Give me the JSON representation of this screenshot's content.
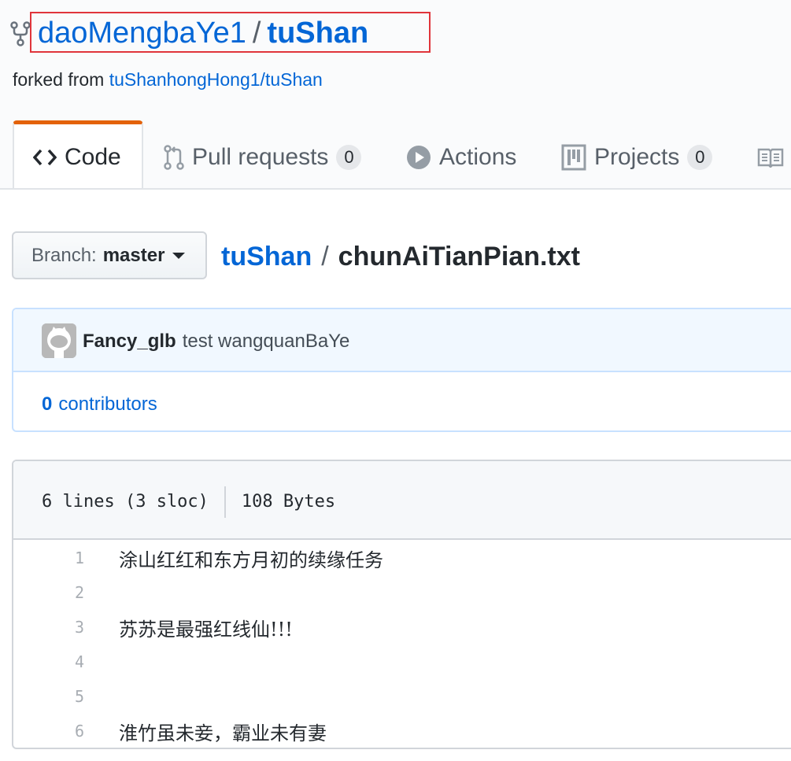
{
  "repo": {
    "owner": "daoMengbaYe1",
    "separator": "/",
    "name": "tuShan",
    "forked_prefix": "forked from",
    "forked_link": "tuShanhongHong1/tuShan"
  },
  "tabs": [
    {
      "label": "Code",
      "icon": "code-icon",
      "selected": true
    },
    {
      "label": "Pull requests",
      "icon": "pull-request-icon",
      "count": "0"
    },
    {
      "label": "Actions",
      "icon": "play-icon"
    },
    {
      "label": "Projects",
      "icon": "project-icon",
      "count": "0"
    },
    {
      "label": "",
      "icon": "book-icon"
    }
  ],
  "branch": {
    "label": "Branch:",
    "name": "master"
  },
  "breadcrumb": {
    "root": "tuShan",
    "separator": "/",
    "file": "chunAiTianPian.txt"
  },
  "commit": {
    "author": "Fancy_glb",
    "message": "test wangquanBaYe"
  },
  "contributors": {
    "count": "0",
    "label": "contributors"
  },
  "file": {
    "lines_info": "6 lines (3 sloc)",
    "size": "108 Bytes",
    "lines": [
      {
        "num": "1",
        "text": "涂山红红和东方月初的续缘任务"
      },
      {
        "num": "2",
        "text": ""
      },
      {
        "num": "3",
        "text": "苏苏是最强红线仙!!!"
      },
      {
        "num": "4",
        "text": ""
      },
      {
        "num": "5",
        "text": ""
      },
      {
        "num": "6",
        "text": "淮竹虽未妾，霸业未有妻"
      }
    ]
  },
  "colors": {
    "link": "#0366d6",
    "tab_accent": "#e36209",
    "highlight_box": "#e0353b"
  }
}
